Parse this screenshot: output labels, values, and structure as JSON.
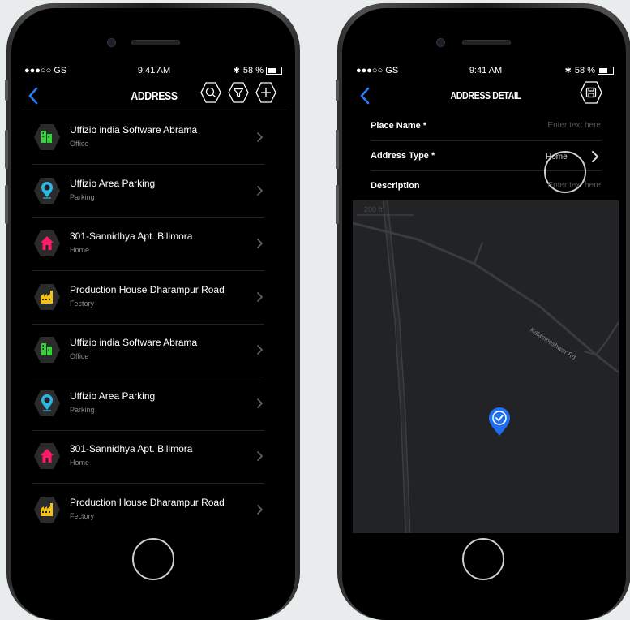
{
  "left": {
    "status": {
      "carrier": "●●●○○ GS",
      "time": "9:41 AM",
      "battery": "58 %"
    },
    "title": "ADDRESS",
    "items": [
      {
        "title": "Uffizio india Software Abrama",
        "subtitle": "Office",
        "icon": "office-building-icon",
        "color": "#33d33a"
      },
      {
        "title": "Uffizio Area Parking",
        "subtitle": "Parking",
        "icon": "parking-pin-icon",
        "color": "#29b8e6"
      },
      {
        "title": "301-Sannidhya Apt. Bilimora",
        "subtitle": "Home",
        "icon": "home-icon",
        "color": "#ff1a66"
      },
      {
        "title": "Production House Dharampur Road",
        "subtitle": "Fectory",
        "icon": "factory-icon",
        "color": "#f2c21b"
      },
      {
        "title": "Uffizio india Software Abrama",
        "subtitle": "Office",
        "icon": "office-building-icon",
        "color": "#33d33a"
      },
      {
        "title": "Uffizio Area Parking",
        "subtitle": "Parking",
        "icon": "parking-pin-icon",
        "color": "#29b8e6"
      },
      {
        "title": "301-Sannidhya Apt. Bilimora",
        "subtitle": "Home",
        "icon": "home-icon",
        "color": "#ff1a66"
      },
      {
        "title": "Production House Dharampur Road",
        "subtitle": "Fectory",
        "icon": "factory-icon",
        "color": "#f2c21b"
      }
    ]
  },
  "right": {
    "status": {
      "carrier": "●●●○○ GS",
      "time": "9:41 AM",
      "battery": "58 %"
    },
    "title": "ADDRESS DETAIL",
    "fields": [
      {
        "label": "Place Name *",
        "value": "Enter text here"
      },
      {
        "label": "Address Type *",
        "value": "Home"
      },
      {
        "label": "Description",
        "value": "Enter text here"
      }
    ],
    "map": {
      "road_label": "Kalambeshwar Rd",
      "scale_label": "200 ft"
    }
  },
  "colors": {
    "accent": "#2d7cf6",
    "pin": "#1e6ff0"
  }
}
